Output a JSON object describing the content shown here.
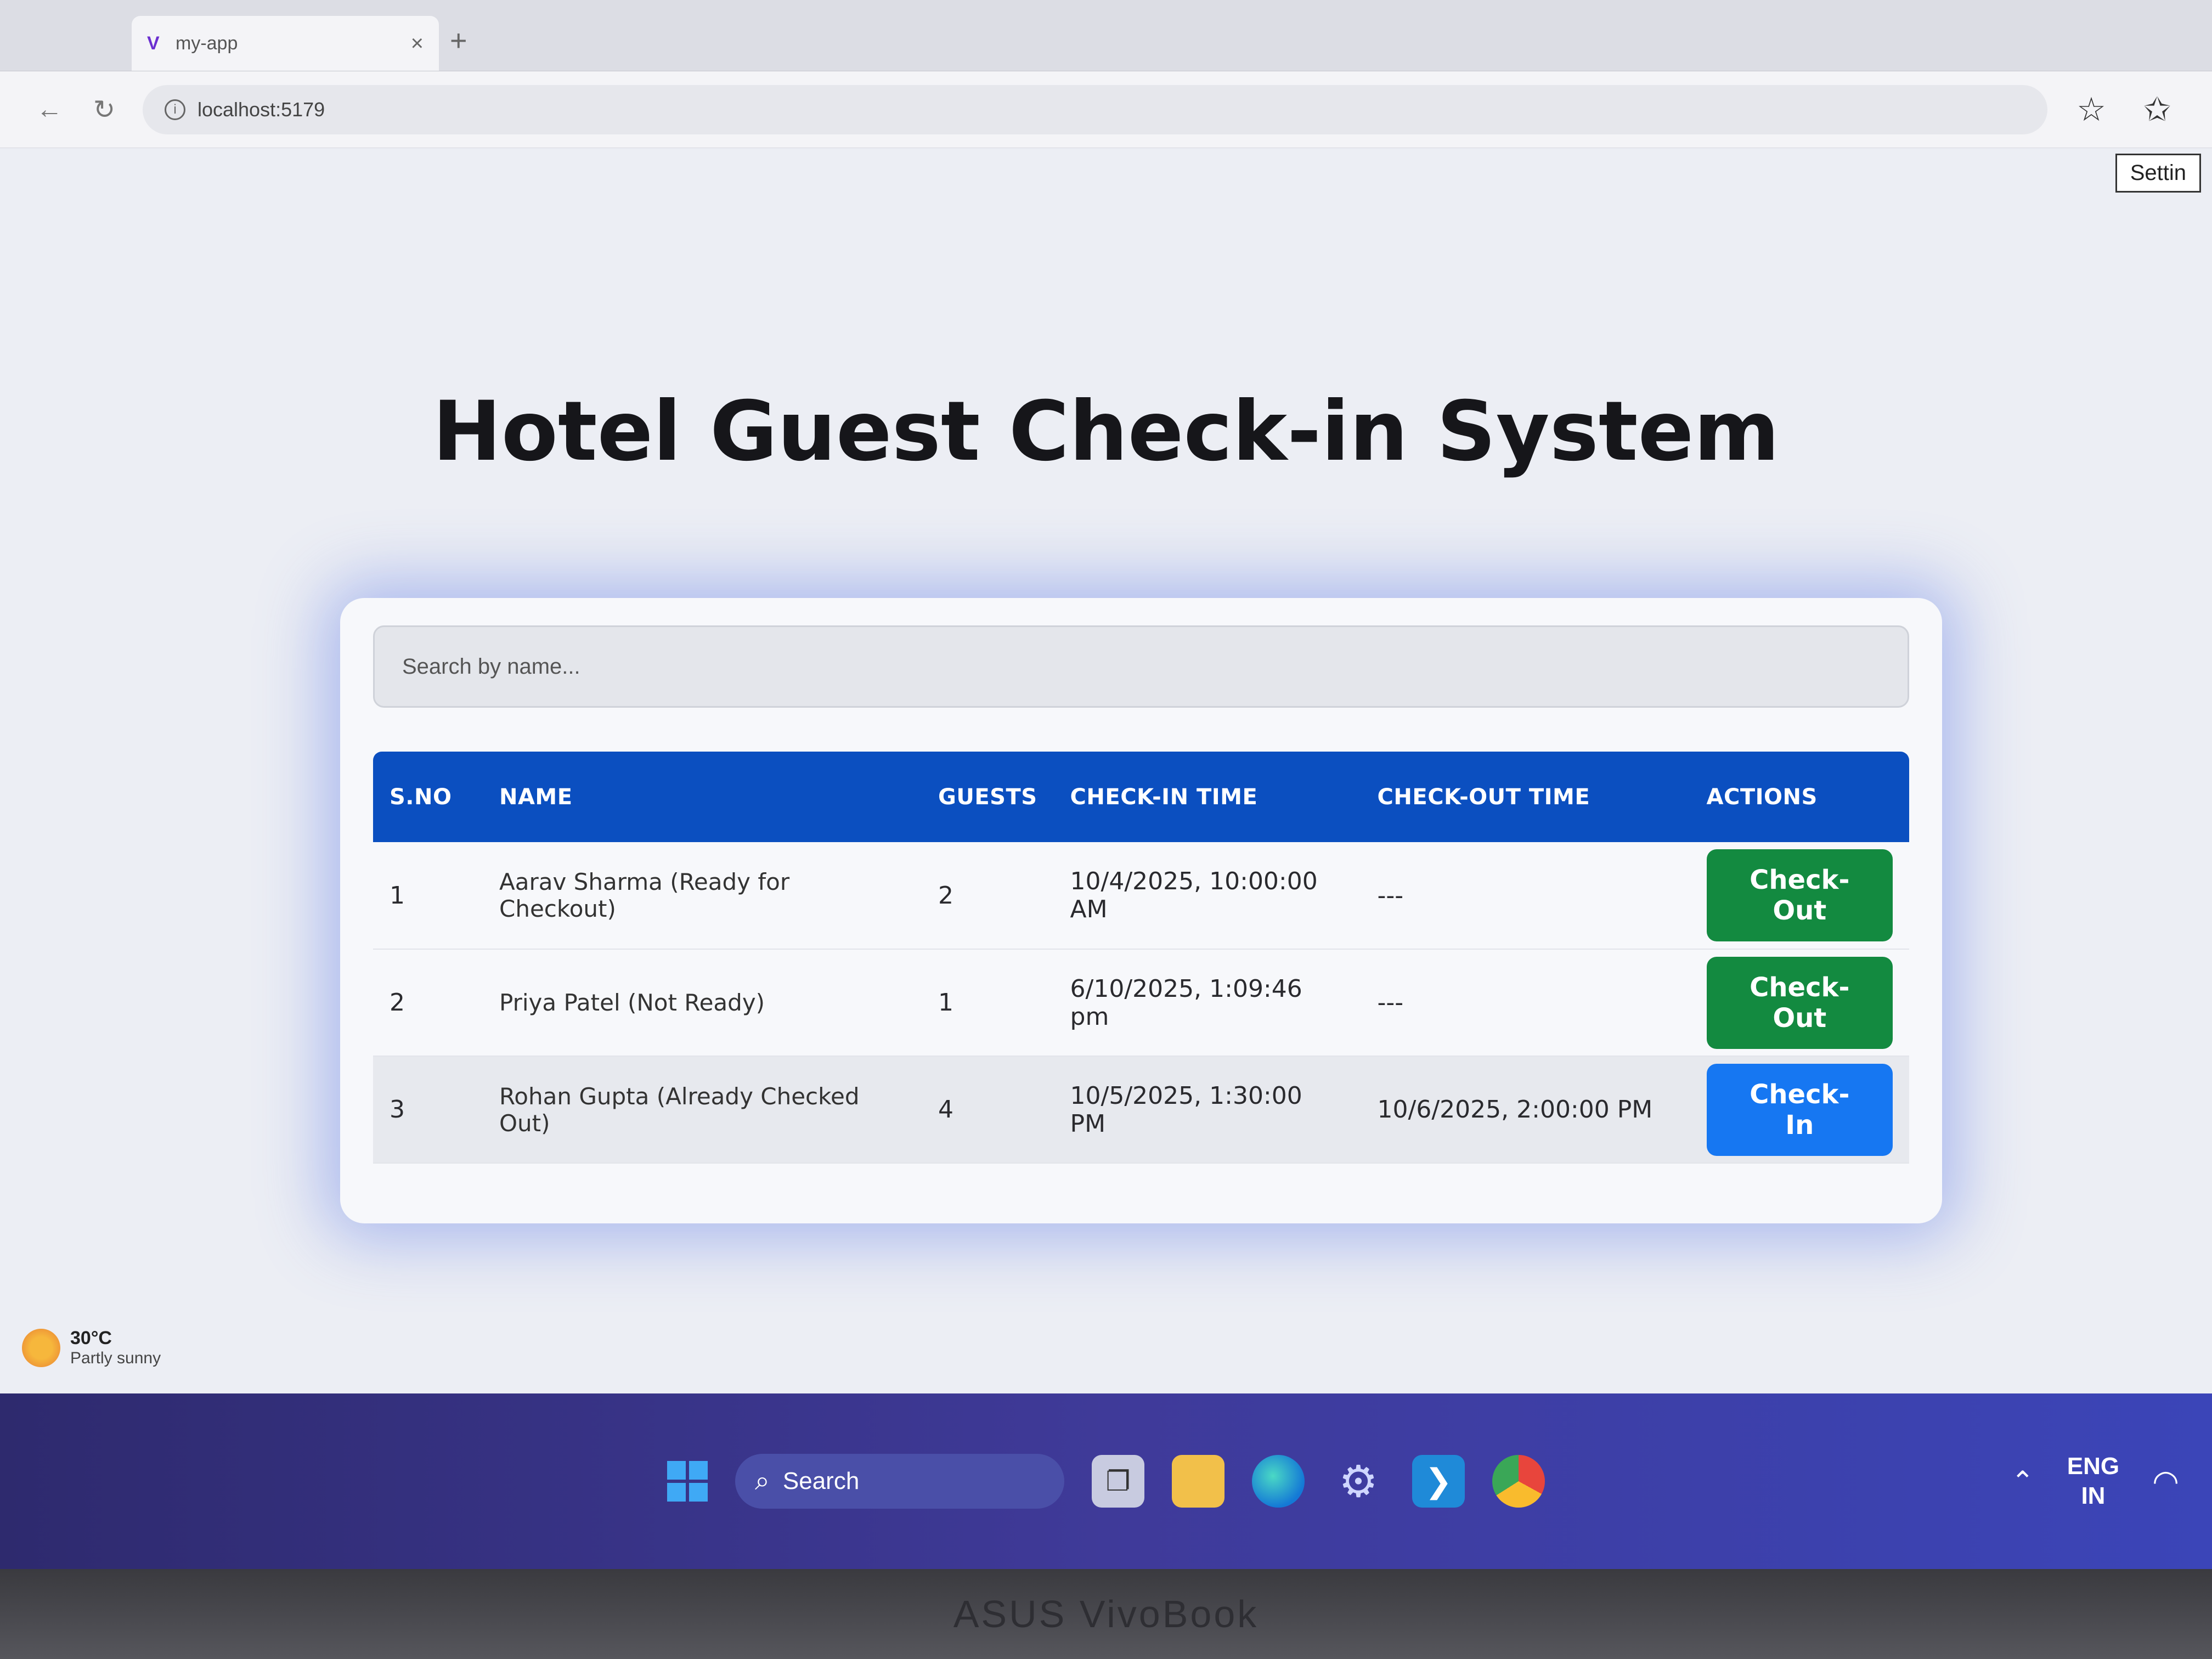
{
  "browser": {
    "tab_title": "my-app",
    "tab_close": "×",
    "new_tab": "+",
    "url": "localhost:5179",
    "settings_tooltip": "Settin"
  },
  "app": {
    "title": "Hotel Guest Check-in System",
    "search_placeholder": "Search by name...",
    "columns": [
      "S.NO",
      "NAME",
      "GUESTS",
      "CHECK-IN TIME",
      "CHECK-OUT TIME",
      "ACTIONS"
    ],
    "rows": [
      {
        "sno": "1",
        "name": "Aarav Sharma (Ready for Checkout)",
        "guests": "2",
        "checkin": "10/4/2025, 10:00:00 AM",
        "checkout": "---",
        "action": "Check-Out"
      },
      {
        "sno": "2",
        "name": "Priya Patel (Not Ready)",
        "guests": "1",
        "checkin": "6/10/2025, 1:09:46 pm",
        "checkout": "---",
        "action": "Check-Out"
      },
      {
        "sno": "3",
        "name": "Rohan Gupta (Already Checked Out)",
        "guests": "4",
        "checkin": "10/5/2025, 1:30:00 PM",
        "checkout": "10/6/2025, 2:00:00 PM",
        "action": "Check-In"
      }
    ],
    "colors": {
      "header": "#0b4fc0",
      "checkout_button": "#138a40",
      "checkin_button": "#1677f2"
    }
  },
  "desktop": {
    "weather_temp": "30°C",
    "weather_condition": "Partly sunny"
  },
  "taskbar": {
    "search_label": "Search",
    "lang_line1": "ENG",
    "lang_line2": "IN",
    "icons": [
      "windows-start-icon",
      "task-view-icon",
      "file-explorer-icon",
      "edge-icon",
      "settings-icon",
      "vscode-icon",
      "chrome-icon"
    ]
  },
  "laptop": {
    "brand": "ASUS VivoBook"
  }
}
